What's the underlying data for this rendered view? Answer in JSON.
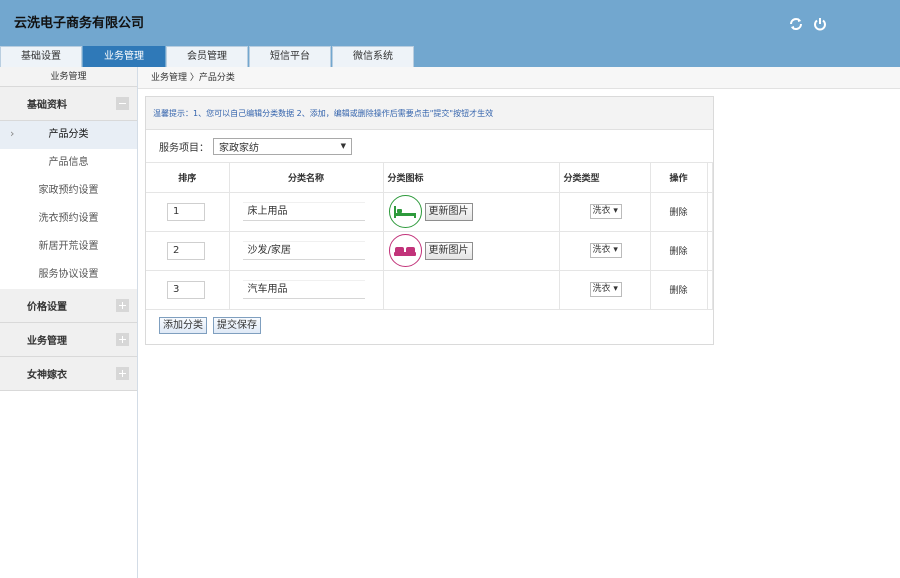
{
  "header": {
    "brand": "云洗电子商务有限公司",
    "icons": [
      "refresh-icon",
      "power-icon"
    ]
  },
  "nav": {
    "tabs": [
      "基础设置",
      "业务管理",
      "会员管理",
      "短信平台",
      "微信系统"
    ],
    "active": 1
  },
  "sidebar": {
    "title": "业务管理",
    "groups": [
      {
        "label": "基础资料",
        "expanded": true,
        "items": [
          "产品分类",
          "产品信息",
          "家政预约设置",
          "洗衣预约设置",
          "新居开荒设置",
          "服务协议设置"
        ]
      },
      {
        "label": "价格设置",
        "expanded": false
      },
      {
        "label": "业务管理",
        "expanded": false
      },
      {
        "label": "女神嫁衣",
        "expanded": false
      }
    ]
  },
  "breadcrumb": "业务管理 〉产品分类",
  "tip": "温馨提示：1、您可以自己编辑分类数据 2、添加，编辑或删除操作后需要点击\"提交\"按钮才生效",
  "service": {
    "label": "服务项目：",
    "value": "家政家纺"
  },
  "table": {
    "headers": [
      "排序",
      "分类名称",
      "分类图标",
      "分类类型",
      "操作"
    ],
    "rows": [
      {
        "order": "1",
        "name": "床上用品",
        "icon": "bed-icon",
        "icon_color": "#2e9a3c",
        "update": "更新图片",
        "type": "洗衣",
        "action": "删除"
      },
      {
        "order": "2",
        "name": "沙发/家居",
        "icon": "sofa-icon",
        "icon_color": "#c2337a",
        "update": "更新图片",
        "type": "洗衣",
        "action": "删除"
      },
      {
        "order": "3",
        "name": "汽车用品",
        "type": "洗衣",
        "action": "删除"
      }
    ]
  },
  "buttons": {
    "add": "添加分类",
    "submit": "提交保存"
  }
}
